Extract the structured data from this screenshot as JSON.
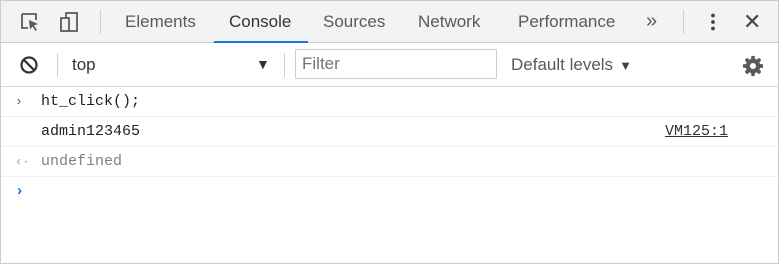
{
  "tabbar": {
    "tabs": [
      "Elements",
      "Console",
      "Sources",
      "Network",
      "Performance"
    ],
    "active_tab": "Console",
    "more_label": "»",
    "close_label": "✕"
  },
  "toolbar": {
    "context": "top",
    "context_caret": "▼",
    "filter_placeholder": "Filter",
    "levels_label": "Default levels",
    "levels_caret": "▼"
  },
  "console": {
    "input_prompt": "›",
    "command": "ht_click();",
    "log_output": "admin123465",
    "log_source": "VM125:1",
    "result_prompt": "‹·",
    "result": "undefined",
    "next_prompt": "›"
  },
  "colors": {
    "accent": "#1a73e8",
    "muted": "#808080",
    "text": "#303942"
  },
  "icons": [
    "inspect-element-icon",
    "device-toggle-icon",
    "kebab-menu-icon",
    "clear-console-icon",
    "settings-gear-icon"
  ]
}
